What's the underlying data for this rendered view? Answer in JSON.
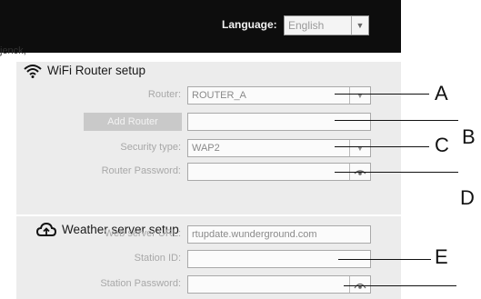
{
  "header": {
    "language_label": "Language:",
    "language_value": "English"
  },
  "corner_text": "jenck,",
  "wifi": {
    "title": "WiFi Router setup",
    "router_label": "Router:",
    "router_value": "ROUTER_A",
    "add_router_label": "Add Router",
    "add_router_value": "",
    "security_label": "Security type:",
    "security_value": "WAP2",
    "password_label": "Router Password:",
    "password_value": ""
  },
  "weather": {
    "title": "Weather server setup",
    "url_label": "Web server URL:",
    "url_value": "rtupdate.wunderground.com",
    "station_id_label": "Station ID:",
    "station_id_value": "",
    "station_password_label": "Station Password:",
    "station_password_value": ""
  },
  "callouts": {
    "a": "A",
    "b": "B",
    "c": "C",
    "d": "D",
    "e": "E"
  },
  "icons": {
    "wifi": "wifi-icon",
    "cloud": "cloud-upload-icon",
    "dropdown": "chevron-down-icon",
    "eye": "eye-icon"
  }
}
